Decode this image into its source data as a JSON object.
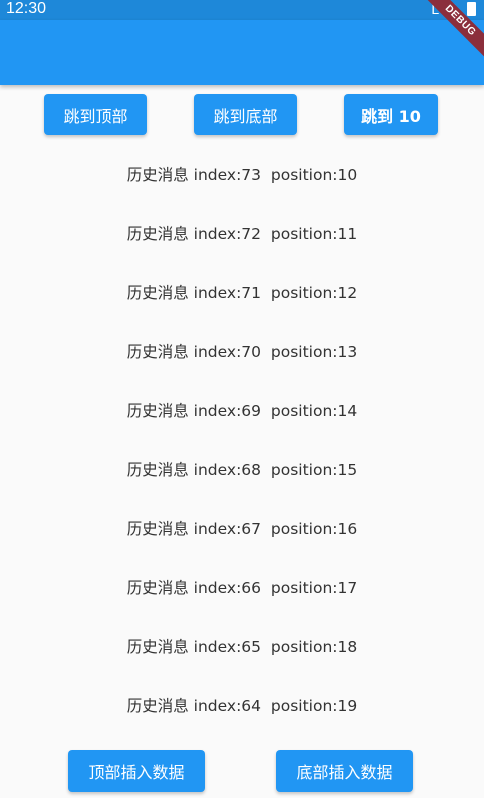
{
  "status_bar": {
    "time": "12:30",
    "network": "LTE",
    "battery_icon": "battery-icon"
  },
  "debug_banner": "DEBUG",
  "buttons": {
    "jump_top": "跳到顶部",
    "jump_bottom": "跳到底部",
    "jump_ten": "跳到 10",
    "insert_top": "顶部插入数据",
    "insert_bottom": "底部插入数据"
  },
  "messages": [
    "历史消息 index:73  position:10",
    "历史消息 index:72  position:11",
    "历史消息 index:71  position:12",
    "历史消息 index:70  position:13",
    "历史消息 index:69  position:14",
    "历史消息 index:68  position:15",
    "历史消息 index:67  position:16",
    "历史消息 index:66  position:17",
    "历史消息 index:65  position:18",
    "历史消息 index:64  position:19"
  ],
  "colors": {
    "primary": "#2196f3",
    "status_bar": "#1e88d9",
    "debug_ribbon": "#8b2e3c",
    "background": "#fafafa",
    "text": "#333333"
  }
}
